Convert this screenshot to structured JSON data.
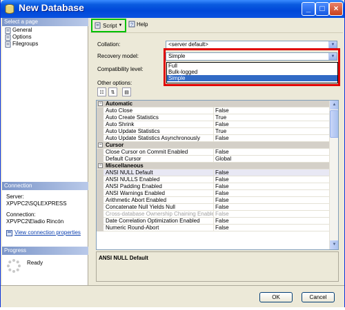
{
  "window": {
    "title": "New Database"
  },
  "left": {
    "select_page_header": "Select a page",
    "pages": [
      "General",
      "Options",
      "Filegroups"
    ],
    "connection_header": "Connection",
    "server_label": "Server:",
    "server_value": "XPVPC2\\SQLEXPRESS",
    "connection_label": "Connection:",
    "connection_value": "XPVPC2\\Eladio Rincón",
    "view_connection": "View connection properties",
    "progress_header": "Progress",
    "progress_status": "Ready"
  },
  "toolbar": {
    "script_label": "Script",
    "help_label": "Help"
  },
  "form": {
    "collation_label": "Collation:",
    "collation_value": "<server default>",
    "recovery_label": "Recovery model:",
    "recovery_value": "Simple",
    "recovery_options": [
      "Full",
      "Bulk-logged",
      "Simple"
    ],
    "recovery_selected_index": 2,
    "compat_label": "Compatibility level:",
    "other_options_label": "Other options:"
  },
  "grid": {
    "sections": [
      {
        "name": "Automatic",
        "rows": [
          {
            "name": "Auto Close",
            "value": "False"
          },
          {
            "name": "Auto Create Statistics",
            "value": "True"
          },
          {
            "name": "Auto Shrink",
            "value": "False"
          },
          {
            "name": "Auto Update Statistics",
            "value": "True"
          },
          {
            "name": "Auto Update Statistics Asynchronously",
            "value": "False"
          }
        ]
      },
      {
        "name": "Cursor",
        "rows": [
          {
            "name": "Close Cursor on Commit Enabled",
            "value": "False"
          },
          {
            "name": "Default Cursor",
            "value": "Global"
          }
        ]
      },
      {
        "name": "Miscellaneous",
        "rows": [
          {
            "name": "ANSI NULL Default",
            "value": "False",
            "highlight": true
          },
          {
            "name": "ANSI NULLS Enabled",
            "value": "False"
          },
          {
            "name": "ANSI Padding Enabled",
            "value": "False"
          },
          {
            "name": "ANSI Warnings Enabled",
            "value": "False"
          },
          {
            "name": "Arithmetic Abort Enabled",
            "value": "False"
          },
          {
            "name": "Concatenate Null Yields Null",
            "value": "False"
          },
          {
            "name": "Cross-database Ownership Chaining Enabled",
            "value": "False",
            "disabled": true
          },
          {
            "name": "Date Correlation Optimization Enabled",
            "value": "False"
          },
          {
            "name": "Numeric Round-Abort",
            "value": "False"
          }
        ]
      }
    ],
    "description_title": "ANSI NULL Default"
  },
  "buttons": {
    "ok": "OK",
    "cancel": "Cancel"
  }
}
